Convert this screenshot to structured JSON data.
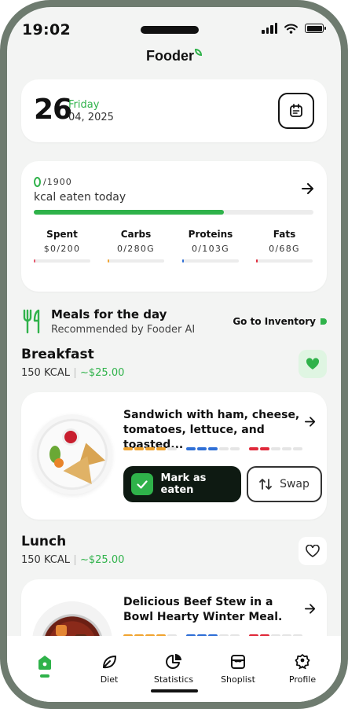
{
  "status_bar": {
    "time": "19:02"
  },
  "app": {
    "brand": "Fooder"
  },
  "date": {
    "day": "26",
    "weekday": "Friday",
    "month_year": "04, 2025"
  },
  "kcal": {
    "eaten": "0",
    "goal": "/1900",
    "label": "kcal eaten today",
    "progress_fraction": 0.68
  },
  "macros": [
    {
      "name": "Spent",
      "value": "$0/200",
      "color": "#e6566b"
    },
    {
      "name": "Carbs",
      "value": "0/280G",
      "color": "#f0a431"
    },
    {
      "name": "Proteins",
      "value": "0/103G",
      "color": "#2f6fd6"
    },
    {
      "name": "Fats",
      "value": "0/68G",
      "color": "#e0293a"
    }
  ],
  "meals_section": {
    "title": "Meals for the day",
    "subtitle": "Recommended by Fooder AI",
    "inventory_link": "Go to Inventory"
  },
  "breakfast": {
    "title": "Breakfast",
    "kcal": "150 KCAL",
    "price": "~$25.00",
    "favorited": true,
    "dish": "Sandwich with ham, cheese, tomatoes, lettuce, and toasted...",
    "mark_eaten": "Mark as eaten",
    "swap": "Swap"
  },
  "lunch": {
    "title": "Lunch",
    "kcal": "150 KCAL",
    "price": "~$25.00",
    "favorited": false,
    "dish": "Delicious Beef Stew in a Bowl Hearty Winter Meal."
  },
  "tabs": [
    "Diet",
    "Statistics",
    "Shoplist",
    "Profile"
  ],
  "colors": {
    "accent": "#2fb24a",
    "dark": "#0e1a12",
    "frame": "#6e7b6f"
  }
}
